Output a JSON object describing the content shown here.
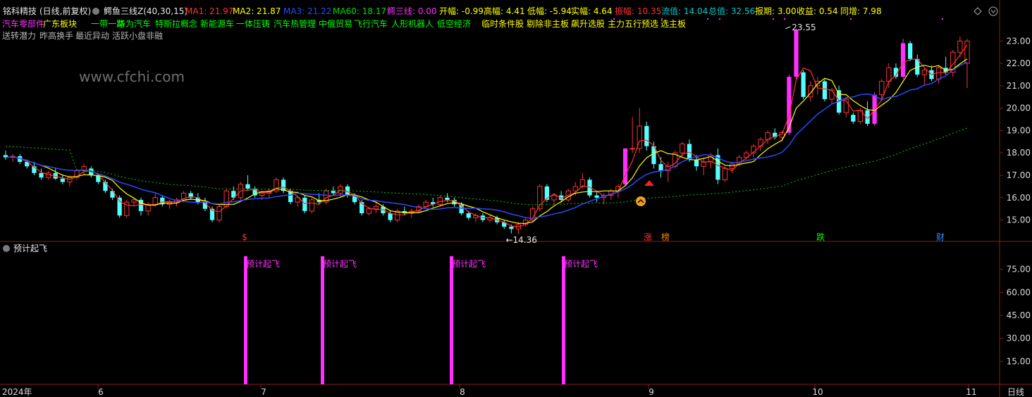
{
  "header": {
    "title": "铭科精技",
    "period": "(日线,前复权)",
    "indicator": "鳄鱼三线Z(40,30,15)",
    "stats": [
      {
        "label": "MA1: 21.97",
        "color": "#ff3030"
      },
      {
        "label": "MA2: 21.87",
        "color": "#ffff00"
      },
      {
        "label": "MA3: 21.22",
        "color": "#2b48ff"
      },
      {
        "label": "MA60: 18.17",
        "color": "#00dd00"
      },
      {
        "label": "鳄三线: 0.00",
        "color": "#ff30ff"
      },
      {
        "label": "开幅: -0.99",
        "color": "#ffff00"
      },
      {
        "label": "高幅: 4.41",
        "color": "#ffff00"
      },
      {
        "label": "低幅: -5.94",
        "color": "#ffff00"
      },
      {
        "label": "实幅: 4.64",
        "color": "#ffff00"
      },
      {
        "label": "振幅: 10.35",
        "color": "#ff3030"
      },
      {
        "label": "流值: 14.04",
        "color": "#00c8c8"
      },
      {
        "label": "总值: 32.56",
        "color": "#00c8c8"
      },
      {
        "label": "报期: 3.00",
        "color": "#ffff00"
      },
      {
        "label": "收益: 0.54",
        "color": "#ffff00"
      },
      {
        "label": "同增: 7.98",
        "color": "#ffff00"
      }
    ]
  },
  "concepts": [
    {
      "text": "汽车零部件",
      "color": "#ff30ff"
    },
    {
      "text": "广东板块",
      "color": "#ffff00"
    },
    {
      "text": "一带一路",
      "color": "#00ff00"
    },
    {
      "text": "华为汽车",
      "color": "#00ff00"
    },
    {
      "text": "特斯拉概念",
      "color": "#00ff00"
    },
    {
      "text": "新能源车",
      "color": "#00ff00"
    },
    {
      "text": "一体压铸",
      "color": "#00ff00"
    },
    {
      "text": "汽车热管理",
      "color": "#00ff00"
    },
    {
      "text": "中俄贸易",
      "color": "#00ff00"
    },
    {
      "text": "飞行汽车",
      "color": "#00ff00"
    },
    {
      "text": "人形机器人",
      "color": "#00ff00"
    },
    {
      "text": "低空经济",
      "color": "#00ff00"
    },
    {
      "text": "临时条件股",
      "color": "#ffff00"
    },
    {
      "text": "剔除非主板",
      "color": "#ffff00"
    },
    {
      "text": "飙升选股",
      "color": "#ffff00"
    },
    {
      "text": "主力五行预选",
      "color": "#ffff00"
    },
    {
      "text": "选主板",
      "color": "#ffff00"
    }
  ],
  "tags_line2": [
    "送转潜力",
    "昨高换手",
    "最近异动",
    "活跃小盘非融"
  ],
  "watermark": "www.cfchi.com",
  "labels": {
    "high_price": "23.55",
    "low_price": "14.36",
    "sub_panel": "预计起飞",
    "bar_label": "预计起飞",
    "period_btn": "日线"
  },
  "markers": [
    {
      "text": "$",
      "color": "#ff3030"
    },
    {
      "text": "涨",
      "color": "#ff3030"
    },
    {
      "text": "榜",
      "color": "#ff8800"
    },
    {
      "text": "跌",
      "color": "#00ff00"
    },
    {
      "text": "财",
      "color": "#2f8cff"
    }
  ],
  "chart_data": {
    "type": "candlestick",
    "x": [
      "2024年",
      "6",
      "7",
      "8",
      "9",
      "10",
      "11"
    ],
    "y_axis_ticks": [
      "23.00",
      "22.00",
      "21.00",
      "20.00",
      "19.00",
      "18.00",
      "17.00",
      "16.00",
      "15.00"
    ],
    "ylim": [
      14.2,
      23.7
    ],
    "high_marker": 23.55,
    "low_marker": 14.36,
    "candles": [
      [
        17.9,
        18.1,
        17.7,
        17.8
      ],
      [
        17.8,
        17.95,
        17.6,
        17.85
      ],
      [
        17.85,
        17.95,
        17.5,
        17.6
      ],
      [
        17.6,
        17.7,
        17.3,
        17.4
      ],
      [
        17.4,
        17.6,
        17.0,
        17.1
      ],
      [
        17.1,
        17.3,
        16.8,
        16.9
      ],
      [
        16.9,
        17.2,
        16.8,
        17.1
      ],
      [
        17.1,
        17.3,
        16.8,
        16.85
      ],
      [
        16.85,
        17.0,
        16.6,
        16.7
      ],
      [
        16.7,
        17.0,
        16.5,
        16.9
      ],
      [
        16.9,
        17.3,
        16.8,
        17.2
      ],
      [
        17.2,
        17.5,
        17.0,
        17.4
      ],
      [
        17.3,
        17.4,
        16.9,
        17.0
      ],
      [
        17.0,
        17.1,
        16.6,
        16.7
      ],
      [
        16.7,
        16.8,
        16.2,
        16.3
      ],
      [
        16.3,
        16.4,
        15.9,
        16.0
      ],
      [
        16.0,
        16.1,
        15.1,
        15.2
      ],
      [
        15.2,
        15.9,
        15.1,
        15.8
      ],
      [
        15.8,
        16.0,
        15.6,
        15.9
      ],
      [
        15.9,
        16.0,
        15.2,
        15.4
      ],
      [
        15.4,
        15.8,
        15.2,
        15.7
      ],
      [
        15.7,
        16.2,
        15.6,
        16.0
      ],
      [
        16.0,
        16.1,
        15.6,
        15.7
      ],
      [
        15.7,
        15.9,
        15.5,
        15.8
      ],
      [
        15.8,
        16.0,
        15.6,
        15.9
      ],
      [
        15.9,
        16.3,
        15.8,
        16.2
      ],
      [
        16.2,
        16.3,
        15.9,
        16.0
      ],
      [
        16.0,
        16.2,
        15.7,
        15.8
      ],
      [
        15.8,
        16.0,
        15.4,
        15.5
      ],
      [
        15.5,
        15.6,
        14.9,
        15.0
      ],
      [
        15.0,
        15.7,
        14.9,
        15.6
      ],
      [
        15.6,
        16.4,
        15.5,
        16.3
      ],
      [
        16.3,
        16.5,
        15.9,
        16.0
      ],
      [
        16.0,
        16.7,
        15.9,
        16.6
      ],
      [
        16.6,
        17.0,
        16.3,
        16.4
      ],
      [
        16.4,
        16.5,
        16.0,
        16.1
      ],
      [
        16.1,
        16.3,
        15.9,
        16.2
      ],
      [
        16.2,
        16.4,
        16.0,
        16.3
      ],
      [
        16.3,
        16.9,
        16.2,
        16.8
      ],
      [
        16.8,
        16.9,
        16.2,
        16.3
      ],
      [
        16.3,
        16.4,
        15.7,
        15.8
      ],
      [
        15.8,
        16.1,
        15.6,
        16.0
      ],
      [
        16.0,
        16.1,
        15.3,
        15.4
      ],
      [
        15.4,
        16.0,
        15.3,
        15.9
      ],
      [
        15.9,
        16.2,
        15.7,
        15.8
      ],
      [
        15.8,
        16.4,
        15.7,
        16.3
      ],
      [
        16.3,
        16.5,
        16.1,
        16.2
      ],
      [
        16.2,
        16.6,
        16.0,
        16.5
      ],
      [
        16.5,
        16.6,
        16.0,
        16.1
      ],
      [
        16.1,
        16.2,
        15.7,
        15.8
      ],
      [
        15.8,
        15.9,
        15.2,
        15.3
      ],
      [
        15.3,
        15.6,
        15.2,
        15.5
      ],
      [
        15.5,
        15.8,
        15.3,
        15.6
      ],
      [
        15.6,
        15.7,
        15.2,
        15.3
      ],
      [
        15.3,
        15.4,
        14.9,
        15.0
      ],
      [
        15.0,
        15.5,
        14.9,
        15.4
      ],
      [
        15.4,
        15.6,
        15.2,
        15.3
      ],
      [
        15.3,
        15.5,
        15.1,
        15.4
      ],
      [
        15.4,
        15.7,
        15.3,
        15.6
      ],
      [
        15.6,
        15.9,
        15.5,
        15.8
      ],
      [
        15.8,
        16.0,
        15.6,
        15.7
      ],
      [
        15.7,
        16.1,
        15.6,
        16.0
      ],
      [
        16.0,
        16.2,
        15.8,
        15.9
      ],
      [
        15.9,
        16.0,
        15.6,
        15.7
      ],
      [
        15.7,
        15.8,
        15.2,
        15.3
      ],
      [
        15.3,
        15.4,
        15.0,
        15.1
      ],
      [
        15.1,
        15.3,
        14.9,
        15.2
      ],
      [
        15.2,
        15.3,
        14.9,
        15.0
      ],
      [
        15.0,
        15.2,
        14.9,
        15.1
      ],
      [
        15.1,
        15.2,
        14.8,
        14.9
      ],
      [
        14.9,
        15.0,
        14.6,
        14.7
      ],
      [
        14.7,
        14.8,
        14.4,
        14.6
      ],
      [
        14.6,
        14.9,
        14.36,
        14.8
      ],
      [
        14.8,
        15.1,
        14.7,
        15.0
      ],
      [
        15.0,
        15.6,
        14.9,
        15.5
      ],
      [
        15.5,
        16.6,
        15.4,
        16.5
      ],
      [
        16.5,
        16.6,
        15.8,
        15.9
      ],
      [
        15.9,
        16.2,
        15.7,
        16.1
      ],
      [
        16.1,
        16.3,
        15.8,
        15.9
      ],
      [
        15.9,
        16.4,
        15.8,
        16.3
      ],
      [
        16.3,
        16.7,
        16.1,
        16.5
      ],
      [
        16.5,
        17.1,
        16.4,
        16.8
      ],
      [
        16.8,
        16.9,
        16.0,
        16.1
      ],
      [
        16.1,
        16.3,
        15.8,
        16.0
      ],
      [
        16.0,
        16.2,
        15.7,
        16.1
      ],
      [
        16.1,
        16.4,
        15.9,
        16.3
      ],
      [
        16.3,
        16.6,
        16.0,
        16.5
      ],
      [
        16.6,
        18.2,
        16.5,
        18.2
      ],
      [
        18.2,
        19.6,
        18.0,
        18.2
      ],
      [
        18.2,
        20.0,
        18.0,
        19.2
      ],
      [
        19.2,
        19.4,
        18.1,
        18.3
      ],
      [
        18.3,
        18.5,
        17.3,
        17.5
      ],
      [
        17.5,
        17.8,
        16.9,
        17.2
      ],
      [
        17.2,
        17.6,
        16.7,
        17.4
      ],
      [
        17.4,
        18.1,
        17.3,
        18.0
      ],
      [
        18.0,
        18.5,
        17.8,
        18.4
      ],
      [
        18.4,
        18.6,
        17.6,
        17.7
      ],
      [
        17.7,
        17.9,
        17.2,
        17.4
      ],
      [
        17.4,
        17.8,
        17.0,
        17.6
      ],
      [
        17.6,
        18.0,
        17.3,
        17.9
      ],
      [
        17.9,
        18.2,
        16.6,
        16.8
      ],
      [
        16.8,
        17.4,
        16.7,
        17.3
      ],
      [
        17.3,
        17.6,
        17.1,
        17.5
      ],
      [
        17.5,
        17.9,
        17.4,
        17.8
      ],
      [
        17.8,
        18.1,
        17.7,
        18.0
      ],
      [
        18.0,
        18.4,
        17.8,
        18.3
      ],
      [
        18.3,
        18.7,
        18.1,
        18.6
      ],
      [
        18.6,
        19.0,
        18.4,
        18.9
      ],
      [
        18.9,
        19.1,
        18.6,
        18.7
      ],
      [
        18.7,
        19.0,
        18.5,
        18.9
      ],
      [
        18.9,
        21.5,
        18.8,
        21.4
      ],
      [
        21.4,
        23.55,
        21.3,
        23.5
      ],
      [
        21.6,
        21.7,
        20.4,
        20.5
      ],
      [
        20.5,
        21.2,
        20.3,
        21.0
      ],
      [
        21.0,
        21.4,
        20.6,
        21.2
      ],
      [
        21.2,
        21.3,
        20.3,
        20.4
      ],
      [
        20.4,
        20.9,
        20.2,
        20.8
      ],
      [
        20.8,
        21.0,
        19.7,
        19.8
      ],
      [
        19.8,
        20.5,
        19.6,
        20.4
      ],
      [
        19.7,
        19.8,
        19.3,
        19.4
      ],
      [
        19.4,
        20.0,
        19.3,
        19.9
      ],
      [
        19.9,
        20.3,
        19.2,
        19.3
      ],
      [
        19.3,
        20.7,
        19.2,
        20.6
      ],
      [
        20.6,
        21.3,
        20.3,
        21.2
      ],
      [
        21.2,
        22.0,
        20.9,
        21.8
      ],
      [
        21.8,
        22.0,
        21.3,
        21.4
      ],
      [
        21.4,
        23.1,
        21.3,
        22.9
      ],
      [
        22.9,
        23.0,
        22.1,
        22.2
      ],
      [
        22.2,
        22.4,
        21.4,
        21.5
      ],
      [
        21.5,
        21.8,
        21.0,
        21.7
      ],
      [
        21.7,
        21.9,
        21.2,
        21.3
      ],
      [
        21.3,
        21.9,
        21.1,
        21.8
      ],
      [
        21.8,
        22.3,
        21.5,
        21.6
      ],
      [
        21.6,
        22.6,
        21.4,
        22.5
      ],
      [
        22.5,
        23.2,
        22.3,
        23.0
      ],
      [
        22.0,
        23.1,
        20.9,
        23.0
      ]
    ],
    "sub_series": {
      "name": "预计起飞",
      "ylim": [
        0,
        90
      ],
      "ticks": [
        "75.00",
        "60.00",
        "45.00",
        "30.00",
        "15.00"
      ],
      "bars_at_candle": [
        29,
        38,
        54,
        64
      ]
    }
  }
}
